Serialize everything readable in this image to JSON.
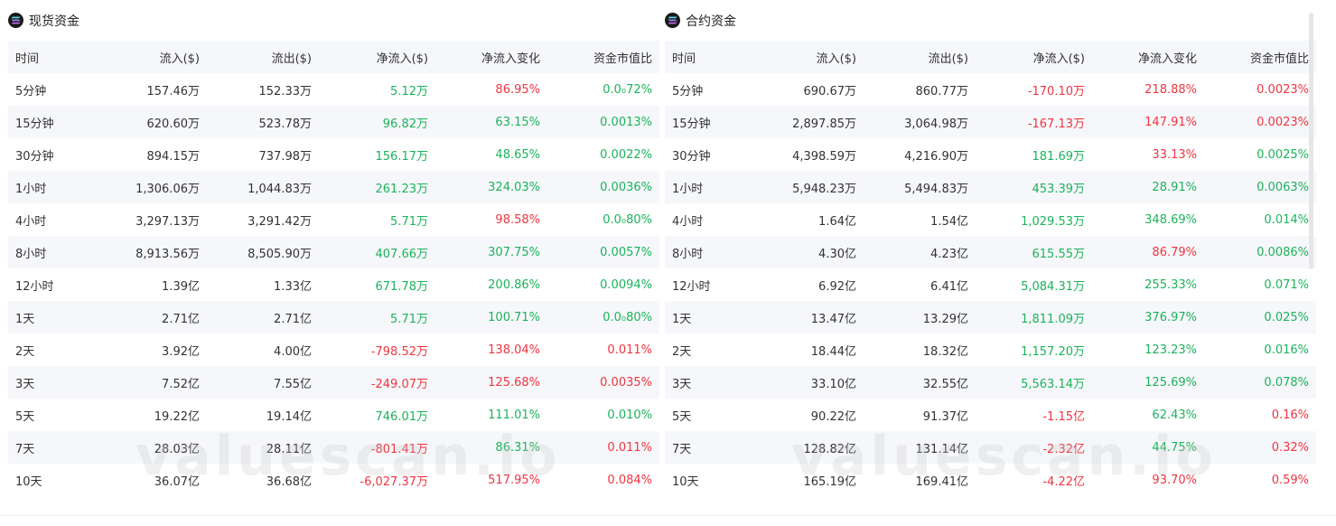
{
  "spot": {
    "title": "现货资金",
    "headers": [
      "时间",
      "流入($)",
      "流出($)",
      "净流入($)",
      "净流入变化",
      "资金市值比"
    ],
    "rows": [
      {
        "time": "5分钟",
        "inflow": "157.46万",
        "outflow": "152.33万",
        "net": "5.12万",
        "net_color": "pos",
        "change": "86.95%",
        "change_color": "neg",
        "ratio": "0.0₀72%",
        "ratio_color": "pos"
      },
      {
        "time": "15分钟",
        "inflow": "620.60万",
        "outflow": "523.78万",
        "net": "96.82万",
        "net_color": "pos",
        "change": "63.15%",
        "change_color": "pos",
        "ratio": "0.0013%",
        "ratio_color": "pos"
      },
      {
        "time": "30分钟",
        "inflow": "894.15万",
        "outflow": "737.98万",
        "net": "156.17万",
        "net_color": "pos",
        "change": "48.65%",
        "change_color": "pos",
        "ratio": "0.0022%",
        "ratio_color": "pos"
      },
      {
        "time": "1小时",
        "inflow": "1,306.06万",
        "outflow": "1,044.83万",
        "net": "261.23万",
        "net_color": "pos",
        "change": "324.03%",
        "change_color": "pos",
        "ratio": "0.0036%",
        "ratio_color": "pos"
      },
      {
        "time": "4小时",
        "inflow": "3,297.13万",
        "outflow": "3,291.42万",
        "net": "5.71万",
        "net_color": "pos",
        "change": "98.58%",
        "change_color": "neg",
        "ratio": "0.0₀80%",
        "ratio_color": "pos"
      },
      {
        "time": "8小时",
        "inflow": "8,913.56万",
        "outflow": "8,505.90万",
        "net": "407.66万",
        "net_color": "pos",
        "change": "307.75%",
        "change_color": "pos",
        "ratio": "0.0057%",
        "ratio_color": "pos"
      },
      {
        "time": "12小时",
        "inflow": "1.39亿",
        "outflow": "1.33亿",
        "net": "671.78万",
        "net_color": "pos",
        "change": "200.86%",
        "change_color": "pos",
        "ratio": "0.0094%",
        "ratio_color": "pos"
      },
      {
        "time": "1天",
        "inflow": "2.71亿",
        "outflow": "2.71亿",
        "net": "5.71万",
        "net_color": "pos",
        "change": "100.71%",
        "change_color": "pos",
        "ratio": "0.0₀80%",
        "ratio_color": "pos"
      },
      {
        "time": "2天",
        "inflow": "3.92亿",
        "outflow": "4.00亿",
        "net": "-798.52万",
        "net_color": "neg",
        "change": "138.04%",
        "change_color": "neg",
        "ratio": "0.011%",
        "ratio_color": "neg"
      },
      {
        "time": "3天",
        "inflow": "7.52亿",
        "outflow": "7.55亿",
        "net": "-249.07万",
        "net_color": "neg",
        "change": "125.68%",
        "change_color": "neg",
        "ratio": "0.0035%",
        "ratio_color": "neg"
      },
      {
        "time": "5天",
        "inflow": "19.22亿",
        "outflow": "19.14亿",
        "net": "746.01万",
        "net_color": "pos",
        "change": "111.01%",
        "change_color": "pos",
        "ratio": "0.010%",
        "ratio_color": "pos"
      },
      {
        "time": "7天",
        "inflow": "28.03亿",
        "outflow": "28.11亿",
        "net": "-801.41万",
        "net_color": "neg",
        "change": "86.31%",
        "change_color": "pos",
        "ratio": "0.011%",
        "ratio_color": "neg"
      },
      {
        "time": "10天",
        "inflow": "36.07亿",
        "outflow": "36.68亿",
        "net": "-6,027.37万",
        "net_color": "neg",
        "change": "517.95%",
        "change_color": "neg",
        "ratio": "0.084%",
        "ratio_color": "neg"
      }
    ]
  },
  "futures": {
    "title": "合约资金",
    "headers": [
      "时间",
      "流入($)",
      "流出($)",
      "净流入($)",
      "净流入变化",
      "资金市值比"
    ],
    "rows": [
      {
        "time": "5分钟",
        "inflow": "690.67万",
        "outflow": "860.77万",
        "net": "-170.10万",
        "net_color": "neg",
        "change": "218.88%",
        "change_color": "neg",
        "ratio": "0.0023%",
        "ratio_color": "neg"
      },
      {
        "time": "15分钟",
        "inflow": "2,897.85万",
        "outflow": "3,064.98万",
        "net": "-167.13万",
        "net_color": "neg",
        "change": "147.91%",
        "change_color": "neg",
        "ratio": "0.0023%",
        "ratio_color": "neg"
      },
      {
        "time": "30分钟",
        "inflow": "4,398.59万",
        "outflow": "4,216.90万",
        "net": "181.69万",
        "net_color": "pos",
        "change": "33.13%",
        "change_color": "neg",
        "ratio": "0.0025%",
        "ratio_color": "pos"
      },
      {
        "time": "1小时",
        "inflow": "5,948.23万",
        "outflow": "5,494.83万",
        "net": "453.39万",
        "net_color": "pos",
        "change": "28.91%",
        "change_color": "pos",
        "ratio": "0.0063%",
        "ratio_color": "pos"
      },
      {
        "time": "4小时",
        "inflow": "1.64亿",
        "outflow": "1.54亿",
        "net": "1,029.53万",
        "net_color": "pos",
        "change": "348.69%",
        "change_color": "pos",
        "ratio": "0.014%",
        "ratio_color": "pos"
      },
      {
        "time": "8小时",
        "inflow": "4.30亿",
        "outflow": "4.23亿",
        "net": "615.55万",
        "net_color": "pos",
        "change": "86.79%",
        "change_color": "neg",
        "ratio": "0.0086%",
        "ratio_color": "pos"
      },
      {
        "time": "12小时",
        "inflow": "6.92亿",
        "outflow": "6.41亿",
        "net": "5,084.31万",
        "net_color": "pos",
        "change": "255.33%",
        "change_color": "pos",
        "ratio": "0.071%",
        "ratio_color": "pos"
      },
      {
        "time": "1天",
        "inflow": "13.47亿",
        "outflow": "13.29亿",
        "net": "1,811.09万",
        "net_color": "pos",
        "change": "376.97%",
        "change_color": "pos",
        "ratio": "0.025%",
        "ratio_color": "pos"
      },
      {
        "time": "2天",
        "inflow": "18.44亿",
        "outflow": "18.32亿",
        "net": "1,157.20万",
        "net_color": "pos",
        "change": "123.23%",
        "change_color": "pos",
        "ratio": "0.016%",
        "ratio_color": "pos"
      },
      {
        "time": "3天",
        "inflow": "33.10亿",
        "outflow": "32.55亿",
        "net": "5,563.14万",
        "net_color": "pos",
        "change": "125.69%",
        "change_color": "pos",
        "ratio": "0.078%",
        "ratio_color": "pos"
      },
      {
        "time": "5天",
        "inflow": "90.22亿",
        "outflow": "91.37亿",
        "net": "-1.15亿",
        "net_color": "neg",
        "change": "62.43%",
        "change_color": "pos",
        "ratio": "0.16%",
        "ratio_color": "neg"
      },
      {
        "time": "7天",
        "inflow": "128.82亿",
        "outflow": "131.14亿",
        "net": "-2.32亿",
        "net_color": "neg",
        "change": "44.75%",
        "change_color": "pos",
        "ratio": "0.32%",
        "ratio_color": "neg"
      },
      {
        "time": "10天",
        "inflow": "165.19亿",
        "outflow": "169.41亿",
        "net": "-4.22亿",
        "net_color": "neg",
        "change": "93.70%",
        "change_color": "neg",
        "ratio": "0.59%",
        "ratio_color": "neg"
      }
    ]
  },
  "watermark": "valuescan.io",
  "icons": {
    "coin": "solana-coin-icon"
  }
}
